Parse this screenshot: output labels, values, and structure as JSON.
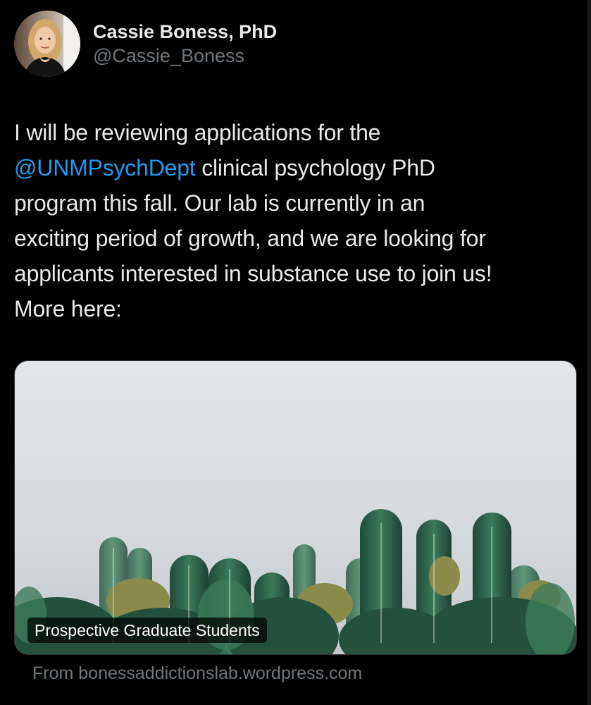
{
  "author": {
    "display_name": "Cassie Boness, PhD",
    "handle": "@Cassie_Boness",
    "avatar_icon": "profile-photo"
  },
  "tweet": {
    "line_1": "I will be reviewing applications for the",
    "mention": "@UNMPsychDept",
    "line_2_rest": " clinical psychology PhD",
    "line_3": "program this fall. Our lab is currently in an",
    "line_4": "exciting period of growth, and we are looking for",
    "line_5": "applicants interested in substance use to join us!",
    "line_6": "More here:"
  },
  "link_card": {
    "title": "Prospective Graduate Students",
    "source": "From bonessaddictionslab.wordpress.com",
    "image_icon": "cactus-photo"
  },
  "colors": {
    "background": "#000000",
    "text": "#e7e9ea",
    "secondary": "#71767b",
    "link": "#1d9bf0"
  }
}
